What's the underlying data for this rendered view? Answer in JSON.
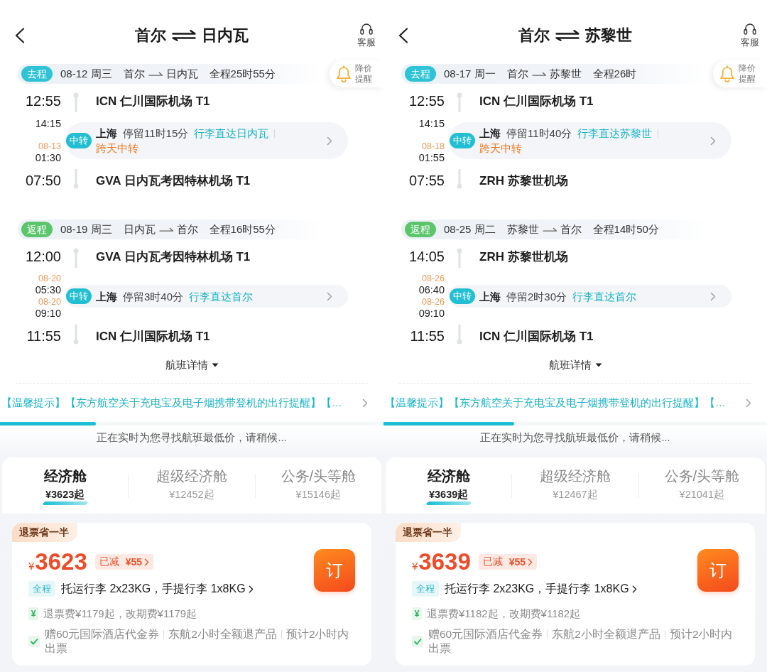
{
  "screens": [
    {
      "header": {
        "from": "首尔",
        "to": "日内瓦",
        "service": "客服"
      },
      "price_alert": "降价提醒",
      "legs": [
        {
          "tag": "去程",
          "color": "#2ec3d5",
          "date": "08-12 周三",
          "from": "首尔",
          "to": "日内瓦",
          "duration": "全程25时55分",
          "departure": {
            "time": "12:55",
            "airport": "ICN 仁川国际机场 T1"
          },
          "transfer": {
            "arrival_time": "14:15",
            "departure_date": "08-13",
            "departure_time": "01:30",
            "badge": "中转",
            "city": "上海",
            "layover": "停留11时15分",
            "baggage": "行李直达日内瓦",
            "note": "跨天中转"
          },
          "arrival": {
            "time": "07:50",
            "airport": "GVA 日内瓦考因特林机场 T1"
          }
        },
        {
          "tag": "返程",
          "color": "#5cc56c",
          "date": "08-19 周三",
          "from": "日内瓦",
          "to": "首尔",
          "duration": "全程16时55分",
          "departure": {
            "time": "12:00",
            "airport": "GVA 日内瓦考因特林机场 T1"
          },
          "transfer": {
            "arrival_date": "08-20",
            "arrival_time": "05:30",
            "departure_date": "08-20",
            "departure_time": "09:10",
            "badge": "中转",
            "city": "上海",
            "layover": "停留3时40分",
            "baggage": "行李直达首尔"
          },
          "arrival": {
            "time": "11:55",
            "airport": "ICN 仁川国际机场 T1"
          }
        }
      ],
      "details_toggle": "航班详情",
      "notice": "【温馨提示】【东方航空关于充电宝及电子烟携带登机的出行提醒】【…",
      "progress": {
        "level": 0.25
      },
      "loading_message": "正在实时为您寻找航班最低价，请稍候...",
      "cabins": [
        {
          "label": "经济舱",
          "price": "¥3623起",
          "selected": true
        },
        {
          "label": "超级经济舱",
          "price": "¥12452起",
          "selected": false
        },
        {
          "label": "公务/头等舱",
          "price": "¥15146起",
          "selected": false
        }
      ],
      "fare": {
        "tag": "退票省一半",
        "currency": "¥",
        "price": "3623",
        "discount_label": "已减",
        "discount_amount": "¥55",
        "book": "订",
        "baggage_scope": "全程",
        "baggage": "托运行李 2x23KG，手提行李 1x8KG",
        "fee_icon": "¥",
        "fees": "退票费¥1179起，改期费¥1179起",
        "benefits": [
          "赠60元国际酒店代金券",
          "东航2小时全额退产品",
          "预计2小时内出票"
        ]
      }
    },
    {
      "header": {
        "from": "首尔",
        "to": "苏黎世",
        "service": "客服"
      },
      "price_alert": "降价提醒",
      "legs": [
        {
          "tag": "去程",
          "color": "#2ec3d5",
          "date": "08-17 周一",
          "from": "首尔",
          "to": "苏黎世",
          "duration": "全程26时",
          "departure": {
            "time": "12:55",
            "airport": "ICN 仁川国际机场 T1"
          },
          "transfer": {
            "arrival_time": "14:15",
            "departure_date": "08-18",
            "departure_time": "01:55",
            "badge": "中转",
            "city": "上海",
            "layover": "停留11时40分",
            "baggage": "行李直达苏黎世",
            "note": "跨天中转"
          },
          "arrival": {
            "time": "07:55",
            "airport": "ZRH 苏黎世机场"
          }
        },
        {
          "tag": "返程",
          "color": "#5cc56c",
          "date": "08-25 周二",
          "from": "苏黎世",
          "to": "首尔",
          "duration": "全程14时50分",
          "departure": {
            "time": "14:05",
            "airport": "ZRH 苏黎世机场"
          },
          "transfer": {
            "arrival_date": "08-26",
            "arrival_time": "06:40",
            "departure_date": "08-26",
            "departure_time": "09:10",
            "badge": "中转",
            "city": "上海",
            "layover": "停留2时30分",
            "baggage": "行李直达首尔"
          },
          "arrival": {
            "time": "11:55",
            "airport": "ICN 仁川国际机场 T1"
          }
        }
      ],
      "details_toggle": "航班详情",
      "notice": "【温馨提示】【东方航空关于充电宝及电子烟携带登机的出行提醒】【…",
      "progress": {
        "level": 0.34
      },
      "loading_message": "正在实时为您寻找航班最低价，请稍候...",
      "cabins": [
        {
          "label": "经济舱",
          "price": "¥3639起",
          "selected": true
        },
        {
          "label": "超级经济舱",
          "price": "¥12467起",
          "selected": false
        },
        {
          "label": "公务/头等舱",
          "price": "¥21041起",
          "selected": false
        }
      ],
      "fare": {
        "tag": "退票省一半",
        "currency": "¥",
        "price": "3639",
        "discount_label": "已减",
        "discount_amount": "¥55",
        "book": "订",
        "baggage_scope": "全程",
        "baggage": "托运行李 2x23KG，手提行李 1x8KG",
        "fee_icon": "¥",
        "fees": "退票费¥1182起，改期费¥1182起",
        "benefits": [
          "赠60元国际酒店代金券",
          "东航2小时全额退产品",
          "预计2小时内出票"
        ]
      }
    }
  ]
}
